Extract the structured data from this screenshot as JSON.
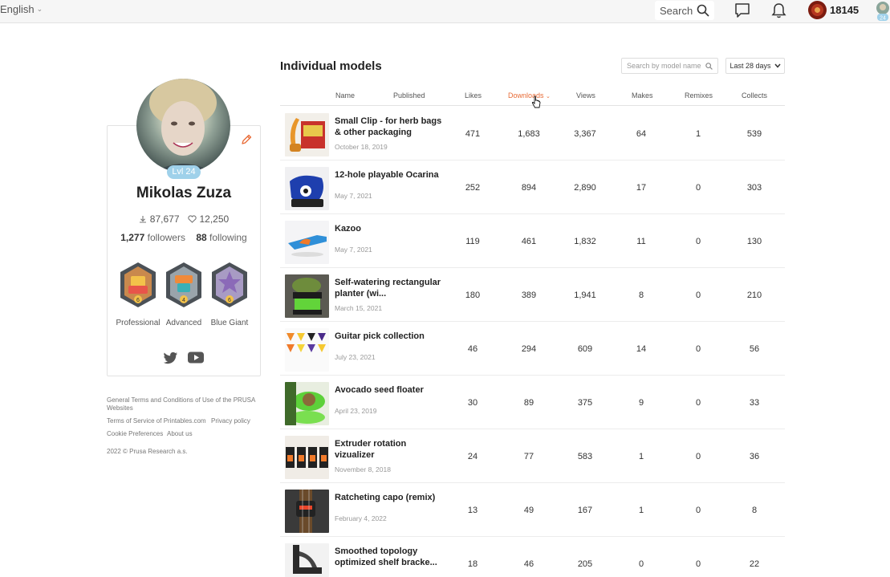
{
  "topbar": {
    "language": "English",
    "search_label": "Search",
    "points": "18145",
    "mini_level": "24"
  },
  "profile": {
    "level": "Lvl 24",
    "name": "Mikolas Zuza",
    "downloads": "87,677",
    "likes": "12,250",
    "followers_count": "1,277",
    "followers_label": "followers",
    "following_count": "88",
    "following_label": "following",
    "badges": [
      {
        "label": "Professional",
        "level": "6",
        "color": "#d9a23a"
      },
      {
        "label": "Advanced",
        "level": "4",
        "color": "#e08a3a"
      },
      {
        "label": "Blue Giant",
        "level": "6",
        "color": "#8b6ab8"
      }
    ]
  },
  "footer": {
    "terms": "General Terms and Conditions of Use of the PRUSA Websites",
    "tos": "Terms of Service of Printables.com",
    "privacy": "Privacy policy",
    "cookies": "Cookie Preferences",
    "about": "About us",
    "copyright": "2022 © Prusa Research a.s."
  },
  "main": {
    "title": "Individual models",
    "search_placeholder": "Search by model name",
    "range": "Last 28 days",
    "columns": {
      "name": "Name",
      "published": "Published",
      "likes": "Likes",
      "downloads": "Downloads",
      "views": "Views",
      "makes": "Makes",
      "remixes": "Remixes",
      "collects": "Collects"
    },
    "rows": [
      {
        "name": "Small Clip - for herb bags & other packaging",
        "date": "October 18, 2019",
        "likes": "471",
        "downloads": "1,683",
        "views": "3,367",
        "makes": "64",
        "remixes": "1",
        "collects": "539"
      },
      {
        "name": "12-hole playable Ocarina",
        "date": "May 7, 2021",
        "likes": "252",
        "downloads": "894",
        "views": "2,890",
        "makes": "17",
        "remixes": "0",
        "collects": "303"
      },
      {
        "name": "Kazoo",
        "date": "May 7, 2021",
        "likes": "119",
        "downloads": "461",
        "views": "1,832",
        "makes": "11",
        "remixes": "0",
        "collects": "130"
      },
      {
        "name": "Self-watering rectangular planter (wi...",
        "date": "March 15, 2021",
        "likes": "180",
        "downloads": "389",
        "views": "1,941",
        "makes": "8",
        "remixes": "0",
        "collects": "210"
      },
      {
        "name": "Guitar pick collection",
        "date": "July 23, 2021",
        "likes": "46",
        "downloads": "294",
        "views": "609",
        "makes": "14",
        "remixes": "0",
        "collects": "56"
      },
      {
        "name": "Avocado seed floater",
        "date": "April 23, 2019",
        "likes": "30",
        "downloads": "89",
        "views": "375",
        "makes": "9",
        "remixes": "0",
        "collects": "33"
      },
      {
        "name": "Extruder rotation vizualizer",
        "date": "November 8, 2018",
        "likes": "24",
        "downloads": "77",
        "views": "583",
        "makes": "1",
        "remixes": "0",
        "collects": "36"
      },
      {
        "name": "Ratcheting capo (remix)",
        "date": "February 4, 2022",
        "likes": "13",
        "downloads": "49",
        "views": "167",
        "makes": "1",
        "remixes": "0",
        "collects": "8"
      },
      {
        "name": "Smoothed topology optimized shelf bracke...",
        "date": "",
        "likes": "18",
        "downloads": "46",
        "views": "205",
        "makes": "0",
        "remixes": "0",
        "collects": "22"
      }
    ]
  }
}
